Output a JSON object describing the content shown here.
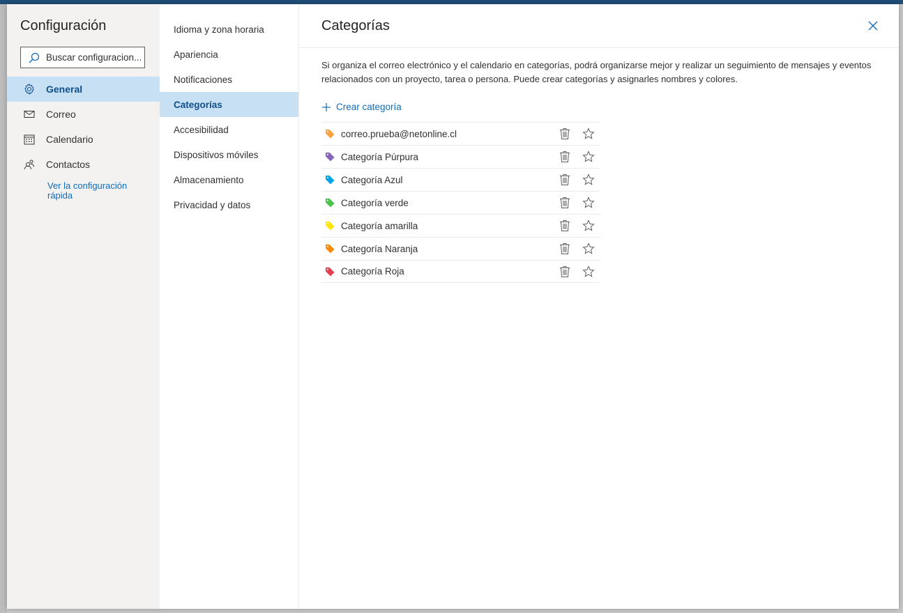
{
  "sidebar": {
    "title": "Configuración",
    "search_placeholder": "Buscar configuracion...",
    "items": [
      {
        "label": "General",
        "icon": "gear-icon",
        "active": true
      },
      {
        "label": "Correo",
        "icon": "mail-icon",
        "active": false
      },
      {
        "label": "Calendario",
        "icon": "calendar-icon",
        "active": false
      },
      {
        "label": "Contactos",
        "icon": "people-icon",
        "active": false
      }
    ],
    "quick_link": "Ver la configuración rápida"
  },
  "subnav": {
    "items": [
      {
        "label": "Idioma y zona horaria",
        "active": false
      },
      {
        "label": "Apariencia",
        "active": false
      },
      {
        "label": "Notificaciones",
        "active": false
      },
      {
        "label": "Categorías",
        "active": true
      },
      {
        "label": "Accesibilidad",
        "active": false
      },
      {
        "label": "Dispositivos móviles",
        "active": false
      },
      {
        "label": "Almacenamiento",
        "active": false
      },
      {
        "label": "Privacidad y datos",
        "active": false
      }
    ]
  },
  "content": {
    "title": "Categorías",
    "description": "Si organiza el correo electrónico y el calendario en categorías, podrá organizarse mejor y realizar un seguimiento de mensajes y eventos relacionados con un proyecto, tarea o persona. Puede crear categorías y asignarles nombres y colores.",
    "create_label": "Crear categoría",
    "categories": [
      {
        "name": "correo.prueba@netonline.cl",
        "color": "#f7a23e"
      },
      {
        "name": "Categoría Púrpura",
        "color": "#8764b8"
      },
      {
        "name": "Categoría Azul",
        "color": "#00a2e8"
      },
      {
        "name": "Categoría verde",
        "color": "#4ac54a"
      },
      {
        "name": "Categoría amarilla",
        "color": "#ffe600"
      },
      {
        "name": "Categoría Naranja",
        "color": "#f7890f"
      },
      {
        "name": "Categoría Roja",
        "color": "#e2404f"
      }
    ]
  },
  "colors": {
    "accent": "#0f6cbd",
    "selected_bg": "#c7e0f4",
    "header_bar": "#1f4e79"
  }
}
